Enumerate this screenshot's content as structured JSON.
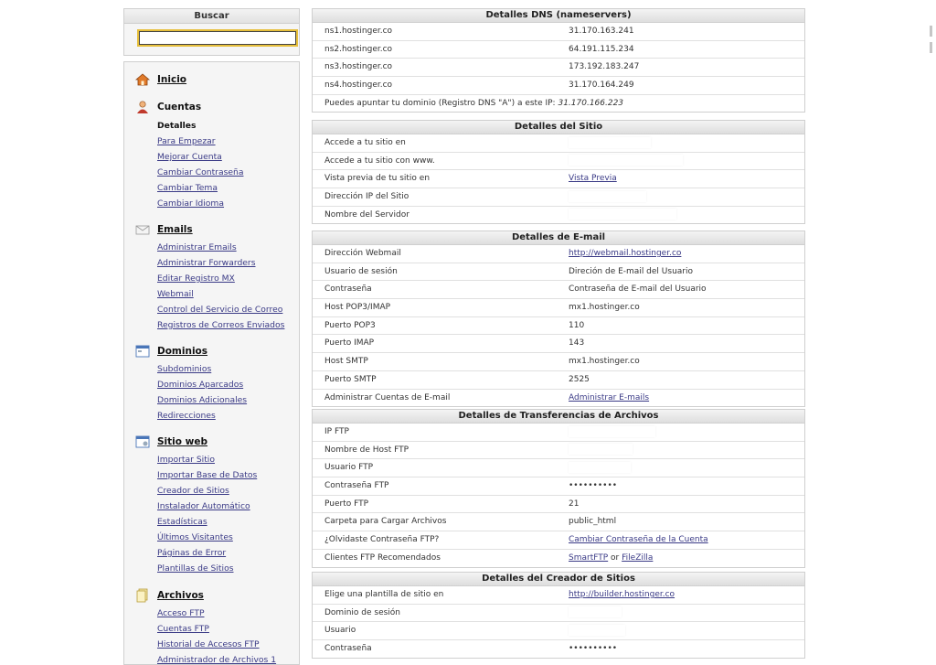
{
  "search": {
    "title": "Buscar",
    "value": ""
  },
  "nav": {
    "inicio": "Inicio",
    "cuentas": {
      "label": "Cuentas",
      "items": [
        "Detalles",
        "Para Empezar",
        "Mejorar Cuenta",
        "Cambiar Contraseña",
        "Cambiar Tema",
        "Cambiar Idioma"
      ]
    },
    "emails": {
      "label": "Emails",
      "items": [
        "Administrar Emails",
        "Administrar Forwarders",
        "Editar Registro MX",
        "Webmail",
        "Control del Servicio de Correo",
        "Registros de Correos Enviados"
      ]
    },
    "dominios": {
      "label": "Dominios",
      "items": [
        "Subdominios",
        "Dominios Aparcados",
        "Dominios Adicionales",
        "Redirecciones"
      ]
    },
    "sitio": {
      "label": "Sitio web",
      "items": [
        "Importar Sitio",
        "Importar Base de Datos",
        "Creador de Sitios",
        "Instalador Automático",
        "Estadísticas",
        "Últimos Visitantes",
        "Páginas de Error",
        "Plantillas de Sitios"
      ]
    },
    "archivos": {
      "label": "Archivos",
      "items": [
        "Acceso FTP",
        "Cuentas FTP",
        "Historial de Accesos FTP",
        "Administrador de Archivos 1"
      ]
    }
  },
  "dns": {
    "title": "Detalles DNS (nameservers)",
    "rows": [
      {
        "k": "ns1.hostinger.co",
        "v": "31.170.163.241"
      },
      {
        "k": "ns2.hostinger.co",
        "v": "64.191.115.234"
      },
      {
        "k": "ns3.hostinger.co",
        "v": "173.192.183.247"
      },
      {
        "k": "ns4.hostinger.co",
        "v": "31.170.164.249"
      }
    ],
    "note": "Puedes apuntar tu dominio (Registro DNS \"A\") a este IP:",
    "note_ip": "31.170.166.223"
  },
  "site": {
    "title": "Detalles del Sitio",
    "rows": [
      "Accede a tu sitio en",
      "Accede a tu sitio con www.",
      "Vista previa de tu sitio en",
      "Dirección IP del Sitio",
      "Nombre del Servidor"
    ],
    "preview_link": "Vista Previa"
  },
  "email": {
    "title": "Detalles de E-mail",
    "rows": [
      {
        "k": "Dirección Webmail",
        "v": "http://webmail.hostinger.co"
      },
      {
        "k": "Usuario de sesión",
        "v": "Direción de E-mail del Usuario"
      },
      {
        "k": "Contraseña",
        "v": "Contraseña de E-mail del Usuario"
      },
      {
        "k": "Host POP3/IMAP",
        "v": "mx1.hostinger.co"
      },
      {
        "k": "Puerto POP3",
        "v": "110"
      },
      {
        "k": "Puerto IMAP",
        "v": "143"
      },
      {
        "k": "Host SMTP",
        "v": "mx1.hostinger.co"
      },
      {
        "k": "Puerto SMTP",
        "v": "2525"
      },
      {
        "k": "Administrar Cuentas de E-mail",
        "v": "Administrar E-mails"
      }
    ]
  },
  "ftp": {
    "title": "Detalles de Transferencias de Archivos",
    "rows": [
      {
        "k": "IP FTP",
        "v": ""
      },
      {
        "k": "Nombre de Host FTP",
        "v": ""
      },
      {
        "k": "Usuario FTP",
        "v": ""
      },
      {
        "k": "Contraseña FTP",
        "v": "••••••••••"
      },
      {
        "k": "Puerto FTP",
        "v": "21"
      },
      {
        "k": "Carpeta para Cargar Archivos",
        "v": "public_html"
      },
      {
        "k": "¿Olvidaste Contraseña FTP?",
        "v": "Cambiar Contraseña de la Cuenta"
      },
      {
        "k": "Clientes FTP Recomendados",
        "v": ""
      }
    ],
    "client_a": "SmartFTP",
    "client_or": "or",
    "client_b": "FileZilla"
  },
  "builder": {
    "title": "Detalles del Creador de Sitios",
    "rows": [
      {
        "k": "Elige una plantilla de sitio en",
        "v": "http://builder.hostinger.co"
      },
      {
        "k": "Dominio de sesión",
        "v": ""
      },
      {
        "k": "Usuario",
        "v": ""
      },
      {
        "k": "Contraseña",
        "v": "••••••••••"
      }
    ]
  }
}
